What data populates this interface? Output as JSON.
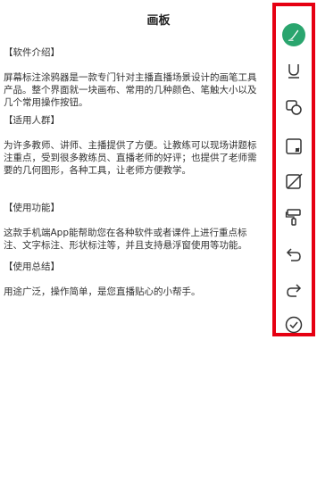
{
  "header": {
    "title": "画板"
  },
  "sections": [
    {
      "heading": "【软件介绍】",
      "lines": [
        "屏幕标注涂鸦器是一款专门针对主播直播场景设计的画笔工具",
        "产品。整个界面就一块画布、常用的几种颜色、笔触大小以及",
        "几个常用操作按钮。"
      ]
    },
    {
      "heading": "【适用人群】",
      "lines": [
        "为许多教师、讲师、主播提供了方便。让教练可以现场讲题标",
        "注重点，受到很多教练员、直播老师的好评；也提供了老师需",
        "要的几何图形，各种工具，让老师方便教学。"
      ]
    },
    {
      "heading": "【使用功能】",
      "lines": [
        "这款手机端App能帮助您在各种软件或者课件上进行重点标",
        "注、文字标注、形状标注等，并且支持悬浮窗使用等功能。"
      ]
    },
    {
      "heading": "【使用总结】",
      "lines": [
        "用途广泛，操作简单，是您直播贴心的小帮手。"
      ]
    }
  ],
  "toolbar": {
    "highlight_color": "#e60012",
    "accent_color": "#2aa56e",
    "tools": [
      {
        "icon": "brush-icon",
        "active": true
      },
      {
        "icon": "underline-icon"
      },
      {
        "icon": "shapes-icon"
      },
      {
        "icon": "sticky-note-icon"
      },
      {
        "icon": "eraser-square-icon"
      },
      {
        "icon": "paint-roller-icon"
      },
      {
        "icon": "undo-icon"
      },
      {
        "icon": "redo-icon"
      },
      {
        "icon": "check-icon"
      }
    ]
  }
}
